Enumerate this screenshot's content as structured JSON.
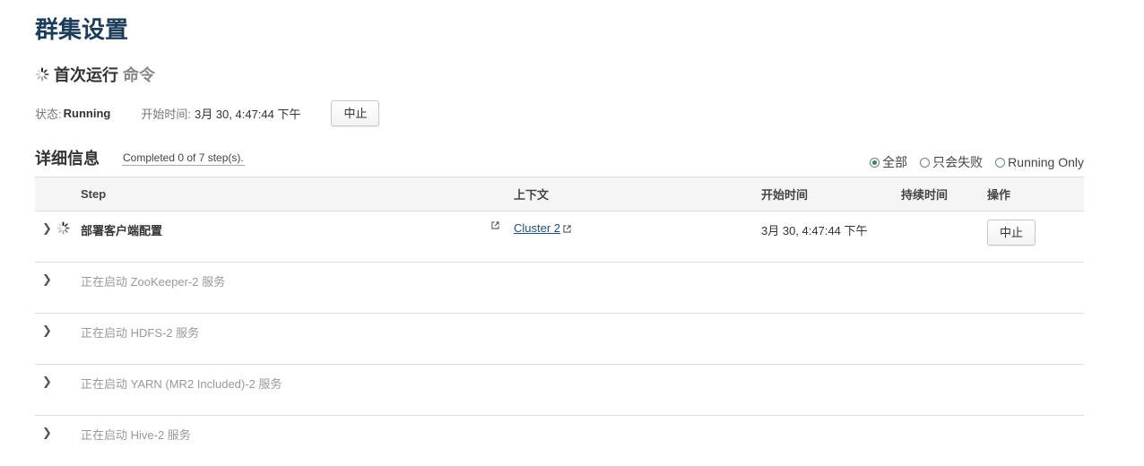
{
  "page_title": "群集设置",
  "command": {
    "title": "首次运行",
    "subtitle": "命令",
    "status_label": "状态:",
    "status_value": "Running",
    "start_label": "开始时间:",
    "start_value": "3月 30, 4:47:44 下午",
    "abort_label": "中止"
  },
  "details": {
    "title": "详细信息",
    "summary": "Completed 0 of 7 step(s).",
    "filters": [
      {
        "label": "全部",
        "checked": true
      },
      {
        "label": "只会失败",
        "checked": false
      },
      {
        "label": "Running Only",
        "checked": false
      }
    ]
  },
  "table": {
    "headers": {
      "step": "Step",
      "context": "上下文",
      "start_time": "开始时间",
      "duration": "持续时间",
      "actions": "操作"
    },
    "rows": [
      {
        "name": "部署客户端配置",
        "context": "Cluster 2",
        "start_time": "3月 30, 4:47:44 下午",
        "duration": "",
        "action": "中止"
      },
      {
        "name": "正在启动 ZooKeeper-2 服务"
      },
      {
        "name": "正在启动 HDFS-2 服务"
      },
      {
        "name": "正在启动 YARN (MR2 Included)-2 服务"
      },
      {
        "name": "正在启动 Hive-2 服务"
      }
    ]
  },
  "icons": {
    "spinner": "loading-spinner-icon",
    "expand": "chevron-right-icon",
    "external": "external-link-icon"
  },
  "colors": {
    "title": "#1c3d5a",
    "link": "#1f4e79",
    "radio_checked": "#2a8c4a",
    "pending_text": "#999999",
    "header_bg": "#f5f5f5"
  }
}
